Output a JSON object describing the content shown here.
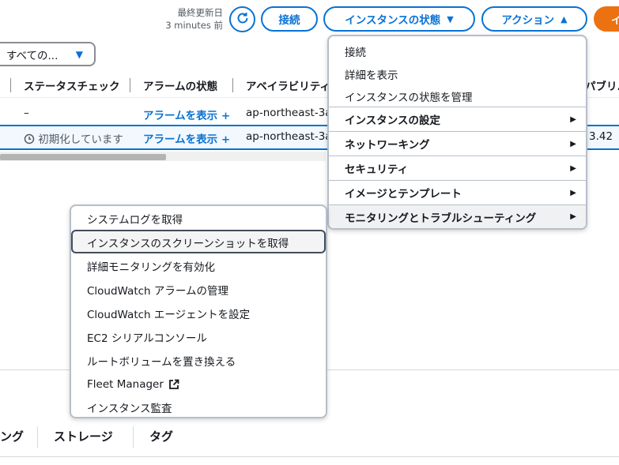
{
  "toolbar": {
    "last_updated_label": "最終更新日",
    "last_updated_value": "3 minutes 前",
    "connect_label": "接続",
    "instance_state_label": "インスタンスの状態",
    "actions_label": "アクション",
    "launch_label": "イ"
  },
  "filter": {
    "selected": "すべての..."
  },
  "table": {
    "headers": [
      "ステータスチェック",
      "アラームの状態",
      "アベイラビリティ",
      "パブリ..."
    ],
    "rows": [
      {
        "status": "–",
        "alarm": "アラームを表示",
        "az": "ap-northeast-3a",
        "ip": ""
      },
      {
        "status": "初期化しています",
        "alarm": "アラームを表示",
        "az": "ap-northeast-3a",
        "ip": "3.42"
      }
    ]
  },
  "actions_menu": {
    "items": [
      {
        "label": "接続",
        "submenu": false
      },
      {
        "label": "詳細を表示",
        "submenu": false
      },
      {
        "label": "インスタンスの状態を管理",
        "submenu": false
      },
      {
        "label": "インスタンスの設定",
        "submenu": true
      },
      {
        "label": "ネットワーキング",
        "submenu": true
      },
      {
        "label": "セキュリティ",
        "submenu": true
      },
      {
        "label": "イメージとテンプレート",
        "submenu": true
      },
      {
        "label": "モニタリングとトラブルシューティング",
        "submenu": true
      }
    ]
  },
  "monitoring_menu": {
    "items": [
      "システムログを取得",
      "インスタンスのスクリーンショットを取得",
      "詳細モニタリングを有効化",
      "CloudWatch アラームの管理",
      "CloudWatch エージェントを設定",
      "EC2 シリアルコンソール",
      "ルートボリュームを置き換える",
      "Fleet Manager",
      "インスタンス監査"
    ]
  },
  "tabs": [
    "ング",
    "ストレージ",
    "タグ"
  ],
  "colors": {
    "accent": "#0972d3",
    "launch_orange": "#ec7211"
  }
}
